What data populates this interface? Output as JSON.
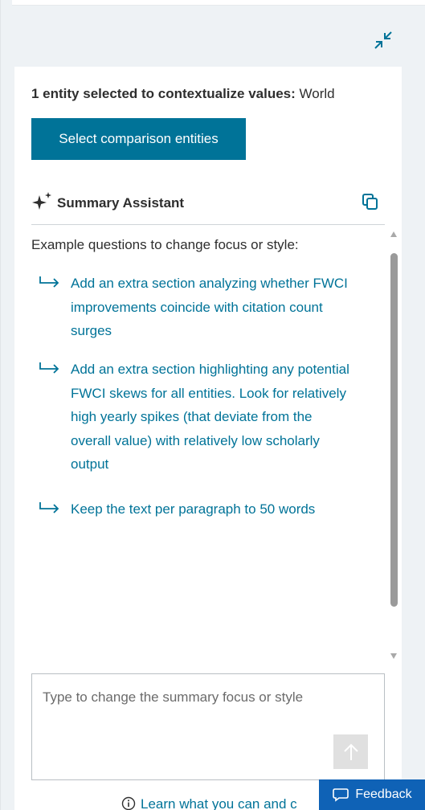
{
  "entity_selection": {
    "prefix": "1 entity selected to contextualize values:",
    "entity": "World",
    "button_label": "Select comparison entities"
  },
  "assistant": {
    "title": "Summary Assistant",
    "intro": "Example questions to change focus or style:",
    "suggestions": [
      "Add an extra section analyzing whether FWCI improvements coincide with citation count surges",
      "Add an extra section highlighting any potential FWCI skews for all entities. Look for relatively high yearly spikes (that deviate from the overall value) with relatively low scholarly output",
      "Keep the text per paragraph to 50 words"
    ],
    "input_placeholder": "Type to change the summary focus or style",
    "learn_text": "Learn what you can and c"
  },
  "feedback": {
    "label": "Feedback"
  },
  "icons": {
    "collapse": "collapse-icon",
    "sparkle": "sparkle-icon",
    "copy": "copy-icon",
    "arrow": "return-arrow-icon",
    "send": "arrow-up-icon",
    "info": "info-icon",
    "chat": "chat-bubble-icon"
  },
  "colors": {
    "accent": "#007398",
    "feedback": "#0f62b6",
    "panel_bg": "#eef2f5"
  }
}
